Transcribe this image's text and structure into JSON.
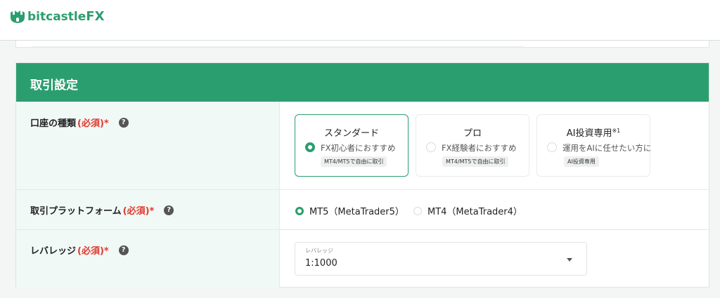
{
  "brand": {
    "name_main": "bitcastle",
    "name_fx": "FX",
    "color": "#2b9e6f"
  },
  "section": {
    "title": "取引設定"
  },
  "account_type": {
    "label": "口座の種類",
    "required": "(必須)*",
    "help": "?",
    "options": [
      {
        "name": "スタンダード",
        "note": "",
        "sub": "FX初心者におすすめ",
        "badge": "MT4/MT5で自由に取引",
        "selected": true
      },
      {
        "name": "プロ",
        "note": "",
        "sub": "FX経験者におすすめ",
        "badge": "MT4/MT5で自由に取引",
        "selected": false
      },
      {
        "name": "AI投資専用",
        "note": "※1",
        "sub": "運用をAIに任せたい方に",
        "badge": "AI投資専用",
        "selected": false
      }
    ]
  },
  "platform": {
    "label": "取引プラットフォーム",
    "required": "(必須)*",
    "help": "?",
    "options": [
      {
        "label": "MT5（MetaTrader5）",
        "selected": true
      },
      {
        "label": "MT4（MetaTrader4）",
        "selected": false
      }
    ]
  },
  "leverage": {
    "label": "レバレッジ",
    "required": "(必須)*",
    "help": "?",
    "caption": "レバレッジ",
    "value": "1:1000"
  }
}
